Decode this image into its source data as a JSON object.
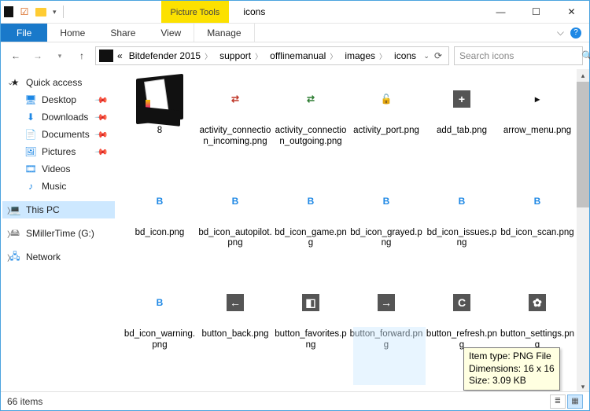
{
  "window": {
    "title": "icons",
    "context_tab": "Picture Tools"
  },
  "ribbon": {
    "file": "File",
    "home": "Home",
    "share": "Share",
    "view": "View",
    "manage": "Manage"
  },
  "address": {
    "crumbs": [
      "Bitdefender 2015",
      "support",
      "offlinemanual",
      "images",
      "icons"
    ],
    "ellipsis": "«"
  },
  "search": {
    "placeholder": "Search icons"
  },
  "navpane": {
    "quick_access": "Quick access",
    "desktop": "Desktop",
    "downloads": "Downloads",
    "documents": "Documents",
    "pictures": "Pictures",
    "videos": "Videos",
    "music": "Music",
    "this_pc": "This PC",
    "drive_g": "SMillerTime (G:)",
    "network": "Network"
  },
  "files": [
    {
      "name": "8",
      "kind": "folder"
    },
    {
      "name": "activity_connection_incoming.png",
      "kind": "png",
      "glyph": "⇄",
      "color": "#c0392b"
    },
    {
      "name": "activity_connection_outgoing.png",
      "kind": "png",
      "glyph": "⇄",
      "color": "#2e7d32"
    },
    {
      "name": "activity_port.png",
      "kind": "png",
      "glyph": "🔓",
      "color": "#e67e22"
    },
    {
      "name": "add_tab.png",
      "kind": "png-dark",
      "glyph": "+"
    },
    {
      "name": "arrow_menu.png",
      "kind": "png",
      "glyph": "▸",
      "color": "#111"
    },
    {
      "name": "bd_icon.png",
      "kind": "png",
      "glyph": "B",
      "color": "#1e88e5"
    },
    {
      "name": "bd_icon_autopilot.png",
      "kind": "png",
      "glyph": "B",
      "color": "#1e88e5"
    },
    {
      "name": "bd_icon_game.png",
      "kind": "png",
      "glyph": "B",
      "color": "#1e88e5"
    },
    {
      "name": "bd_icon_grayed.png",
      "kind": "png",
      "glyph": "B",
      "color": "#1e88e5"
    },
    {
      "name": "bd_icon_issues.png",
      "kind": "png",
      "glyph": "B",
      "color": "#1e88e5"
    },
    {
      "name": "bd_icon_scan.png",
      "kind": "png",
      "glyph": "B",
      "color": "#1e88e5"
    },
    {
      "name": "bd_icon_warning.png",
      "kind": "png",
      "glyph": "B",
      "color": "#1e88e5"
    },
    {
      "name": "button_back.png",
      "kind": "png-dark",
      "glyph": "←"
    },
    {
      "name": "button_favorites.png",
      "kind": "png-dark",
      "glyph": "◧"
    },
    {
      "name": "button_forward.png",
      "kind": "png-dark",
      "glyph": "→"
    },
    {
      "name": "button_refresh.png",
      "kind": "png-dark",
      "glyph": "C"
    },
    {
      "name": "button_settings.png",
      "kind": "png-dark",
      "glyph": "✿"
    }
  ],
  "tooltip": {
    "line1": "Item type: PNG File",
    "line2": "Dimensions: 16 x 16",
    "line3": "Size: 3.09 KB"
  },
  "status": {
    "count": "66 items"
  }
}
